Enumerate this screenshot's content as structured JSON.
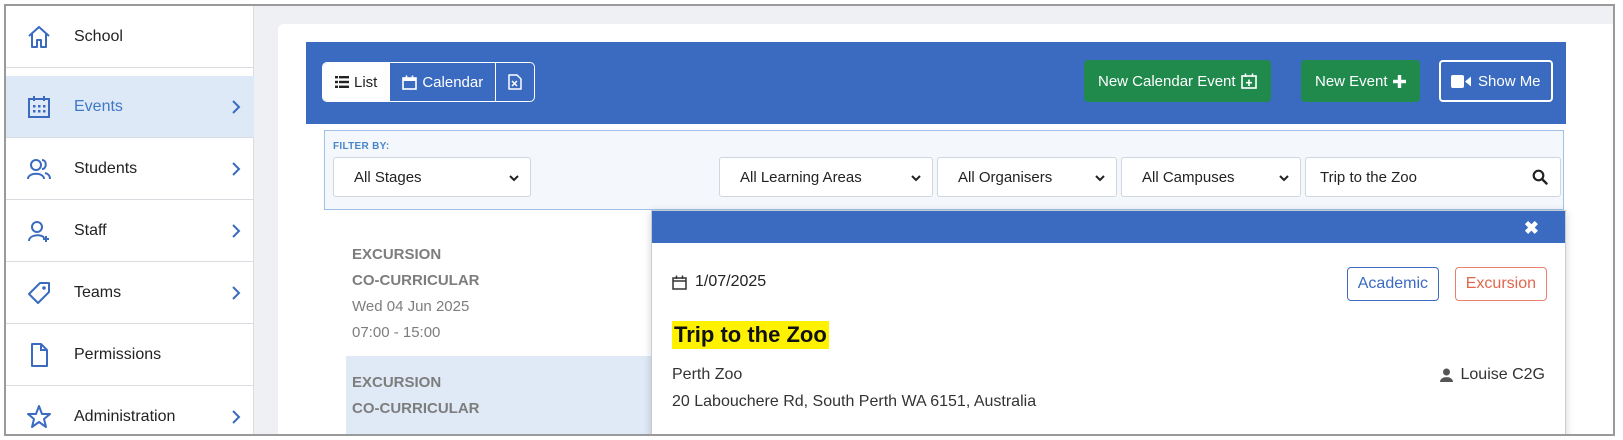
{
  "sidebar": {
    "items": [
      {
        "label": "School",
        "icon": "home-icon"
      },
      {
        "label": "Events",
        "icon": "calendar-grid-icon",
        "active": true
      },
      {
        "label": "Students",
        "icon": "users-icon"
      },
      {
        "label": "Staff",
        "icon": "user-add-icon"
      },
      {
        "label": "Teams",
        "icon": "tag-icon"
      },
      {
        "label": "Permissions",
        "icon": "document-icon"
      },
      {
        "label": "Administration",
        "icon": "star-icon"
      }
    ]
  },
  "toolbar": {
    "views": [
      {
        "label": "List",
        "icon": "list-icon",
        "active": true
      },
      {
        "label": "Calendar",
        "icon": "calendar-icon",
        "active": false
      },
      {
        "label": "",
        "icon": "export-excel-icon",
        "active": false
      }
    ],
    "new_calendar_event_label": "New Calendar Event",
    "new_event_label": "New Event",
    "show_me_label": "Show Me"
  },
  "filters": {
    "label": "FILTER BY:",
    "stages": "All Stages",
    "learning_areas": "All Learning Areas",
    "organisers": "All Organisers",
    "campuses": "All Campuses",
    "search_value": "Trip to the Zoo"
  },
  "events": [
    {
      "type": "EXCURSION",
      "subtype": "CO-CURRICULAR",
      "date": "Wed 04 Jun 2025",
      "time": "07:00 - 15:00"
    },
    {
      "type": "EXCURSION",
      "subtype": "CO-CURRICULAR"
    }
  ],
  "popover": {
    "close_symbol": "✖",
    "date": "1/07/2025",
    "tags": [
      "Academic",
      "Excursion"
    ],
    "title": "Trip to the Zoo",
    "venue": "Perth Zoo",
    "address": "20 Labouchere Rd, South Perth WA 6151, Australia",
    "organiser": "Louise C2G"
  },
  "colors": {
    "primary": "#3a6bc0",
    "green": "#1f8a4c",
    "highlight": "#fff200",
    "excursion": "#e0674e"
  }
}
